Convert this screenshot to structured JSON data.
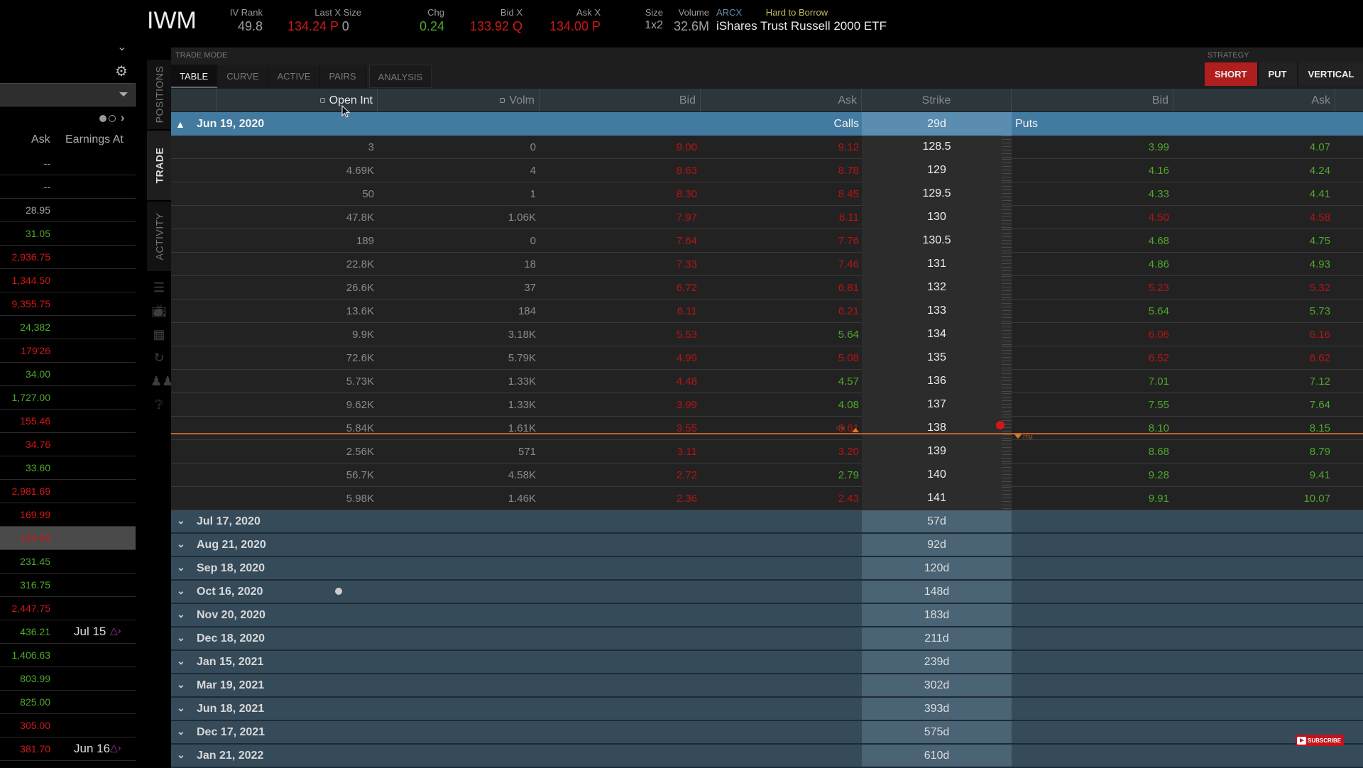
{
  "header": {
    "symbol": "IWM",
    "iv_rank": {
      "label": "IV Rank",
      "value": "49.8"
    },
    "last_x_size": {
      "label": "Last X Size",
      "value": "134.24 P",
      "size": "0"
    },
    "chg": {
      "label": "Chg",
      "value": "0.24"
    },
    "bid_x": {
      "label": "Bid X",
      "value": "133.92 Q"
    },
    "ask_x": {
      "label": "Ask X",
      "value": "134.00 P"
    },
    "size": {
      "label": "Size",
      "value": "1x2"
    },
    "volume": {
      "label": "Volume",
      "value": "32.6M"
    },
    "exchange": "ARCX",
    "borrow_status": "Hard to Borrow",
    "description": "iShares Trust Russell 2000 ETF"
  },
  "watchlist": {
    "columns": {
      "ask": "Ask",
      "earnings": "Earnings At"
    },
    "rows": [
      {
        "ask": "--",
        "color": "grey"
      },
      {
        "ask": "--",
        "color": "grey"
      },
      {
        "ask": "28.95",
        "color": "grey"
      },
      {
        "ask": "31.05",
        "color": "green"
      },
      {
        "ask": "2,936.75",
        "color": "red"
      },
      {
        "ask": "1,344.50",
        "color": "red"
      },
      {
        "ask": "9,355.75",
        "color": "red"
      },
      {
        "ask": "24,382",
        "color": "green"
      },
      {
        "ask": "179'26",
        "color": "red"
      },
      {
        "ask": "34.00",
        "color": "green"
      },
      {
        "ask": "1,727.00",
        "color": "green"
      },
      {
        "ask": "155.46",
        "color": "red"
      },
      {
        "ask": "34.76",
        "color": "red"
      },
      {
        "ask": "33.60",
        "color": "green"
      },
      {
        "ask": "2,981.69",
        "color": "red"
      },
      {
        "ask": "169.99",
        "color": "red"
      },
      {
        "ask": "134.00",
        "color": "red",
        "selected": true
      },
      {
        "ask": "231.45",
        "color": "green"
      },
      {
        "ask": "316.75",
        "color": "green"
      },
      {
        "ask": "2,447.75",
        "color": "red"
      },
      {
        "ask": "436.21",
        "color": "green",
        "earnings": "Jul 15"
      },
      {
        "ask": "1,406.63",
        "color": "green"
      },
      {
        "ask": "803.99",
        "color": "green"
      },
      {
        "ask": "825.00",
        "color": "green"
      },
      {
        "ask": "305.00",
        "color": "red"
      },
      {
        "ask": "381.70",
        "color": "red",
        "earnings": "Jun 16"
      }
    ]
  },
  "side_tabs": [
    "POSITIONS",
    "TRADE",
    "ACTIVITY"
  ],
  "active_side_tab": "TRADE",
  "trade_mode": {
    "label": "TRADE MODE",
    "tabs": [
      "TABLE",
      "CURVE",
      "ACTIVE",
      "PAIRS",
      "ANALYSIS"
    ],
    "active": "TABLE"
  },
  "strategy": {
    "label": "STRATEGY",
    "buttons": [
      "SHORT",
      "PUT",
      "VERTICAL"
    ],
    "active": "SHORT"
  },
  "chain": {
    "columns": {
      "open_int": "Open Int",
      "volm": "Volm",
      "call_bid": "Bid",
      "call_ask": "Ask",
      "strike": "Strike",
      "put_bid": "Bid",
      "put_ask": "Ask"
    },
    "expanded": {
      "date": "Jun 19, 2020",
      "calls_label": "Calls",
      "dte": "29d",
      "puts_label": "Puts"
    },
    "rows": [
      {
        "oi": "3",
        "vol": "0",
        "cb": "9.00",
        "cbc": "red",
        "ca": "9.12",
        "cac": "red",
        "strike": "128.5",
        "pb": "3.99",
        "pbc": "green",
        "pa": "4.07",
        "pac": "green"
      },
      {
        "oi": "4.69K",
        "vol": "4",
        "cb": "8.63",
        "cbc": "red",
        "ca": "8.78",
        "cac": "red",
        "strike": "129",
        "pb": "4.16",
        "pbc": "green",
        "pa": "4.24",
        "pac": "green"
      },
      {
        "oi": "50",
        "vol": "1",
        "cb": "8.30",
        "cbc": "red",
        "ca": "8.45",
        "cac": "red",
        "strike": "129.5",
        "pb": "4.33",
        "pbc": "green",
        "pa": "4.41",
        "pac": "green"
      },
      {
        "oi": "47.8K",
        "vol": "1.06K",
        "cb": "7.97",
        "cbc": "red",
        "ca": "8.11",
        "cac": "red",
        "strike": "130",
        "pb": "4.50",
        "pbc": "red",
        "pa": "4.58",
        "pac": "red"
      },
      {
        "oi": "189",
        "vol": "0",
        "cb": "7.64",
        "cbc": "red",
        "ca": "7.76",
        "cac": "red",
        "strike": "130.5",
        "pb": "4.68",
        "pbc": "green",
        "pa": "4.75",
        "pac": "green"
      },
      {
        "oi": "22.8K",
        "vol": "18",
        "cb": "7.33",
        "cbc": "red",
        "ca": "7.46",
        "cac": "red",
        "strike": "131",
        "pb": "4.86",
        "pbc": "green",
        "pa": "4.93",
        "pac": "green"
      },
      {
        "oi": "26.6K",
        "vol": "37",
        "cb": "6.72",
        "cbc": "red",
        "ca": "6.81",
        "cac": "red",
        "strike": "132",
        "pb": "5.23",
        "pbc": "red",
        "pa": "5.32",
        "pac": "red"
      },
      {
        "oi": "13.6K",
        "vol": "184",
        "cb": "6.11",
        "cbc": "red",
        "ca": "6.21",
        "cac": "red",
        "strike": "133",
        "pb": "5.64",
        "pbc": "green",
        "pa": "5.73",
        "pac": "green"
      },
      {
        "oi": "9.9K",
        "vol": "3.18K",
        "cb": "5.53",
        "cbc": "red",
        "ca": "5.64",
        "cac": "green",
        "strike": "134",
        "pb": "6.06",
        "pbc": "red",
        "pa": "6.16",
        "pac": "red"
      },
      {
        "oi": "72.6K",
        "vol": "5.79K",
        "cb": "4.99",
        "cbc": "red",
        "ca": "5.08",
        "cac": "red",
        "strike": "135",
        "pb": "6.52",
        "pbc": "red",
        "pa": "6.62",
        "pac": "red"
      },
      {
        "oi": "5.73K",
        "vol": "1.33K",
        "cb": "4.48",
        "cbc": "red",
        "ca": "4.57",
        "cac": "green",
        "strike": "136",
        "pb": "7.01",
        "pbc": "green",
        "pa": "7.12",
        "pac": "green"
      },
      {
        "oi": "9.62K",
        "vol": "1.33K",
        "cb": "3.99",
        "cbc": "red",
        "ca": "4.08",
        "cac": "green",
        "strike": "137",
        "pb": "7.55",
        "pbc": "green",
        "pa": "7.64",
        "pac": "green"
      },
      {
        "oi": "5.84K",
        "vol": "1.61K",
        "cb": "3.55",
        "cbc": "red",
        "ca": "3.61",
        "cac": "red",
        "strike": "138",
        "pb": "8.10",
        "pbc": "green",
        "pa": "8.15",
        "pac": "green"
      },
      {
        "oi": "2.56K",
        "vol": "571",
        "cb": "3.11",
        "cbc": "red",
        "ca": "3.20",
        "cac": "red",
        "strike": "139",
        "pb": "8.68",
        "pbc": "green",
        "pa": "8.79",
        "pac": "green"
      },
      {
        "oi": "56.7K",
        "vol": "4.58K",
        "cb": "2.72",
        "cbc": "red",
        "ca": "2.79",
        "cac": "green",
        "strike": "140",
        "pb": "9.28",
        "pbc": "green",
        "pa": "9.41",
        "pac": "green"
      },
      {
        "oi": "5.98K",
        "vol": "1.46K",
        "cb": "2.36",
        "cbc": "red",
        "ca": "2.43",
        "cac": "red",
        "strike": "141",
        "pb": "9.91",
        "pbc": "green",
        "pa": "10.07",
        "pac": "green"
      }
    ],
    "itm_label": "ITM",
    "expirations": [
      {
        "date": "Jul 17, 2020",
        "dte": "57d"
      },
      {
        "date": "Aug 21, 2020",
        "dte": "92d"
      },
      {
        "date": "Sep 18, 2020",
        "dte": "120d"
      },
      {
        "date": "Oct 16, 2020",
        "dte": "148d",
        "marker": true
      },
      {
        "date": "Nov 20, 2020",
        "dte": "183d"
      },
      {
        "date": "Dec 18, 2020",
        "dte": "211d"
      },
      {
        "date": "Jan 15, 2021",
        "dte": "239d"
      },
      {
        "date": "Mar 19, 2021",
        "dte": "302d"
      },
      {
        "date": "Jun 18, 2021",
        "dte": "393d"
      },
      {
        "date": "Dec 17, 2021",
        "dte": "575d"
      },
      {
        "date": "Jan 21, 2022",
        "dte": "610d"
      }
    ]
  },
  "overlay": {
    "subscribe": "SUBSCRIBE"
  },
  "colors": {
    "red": "#b51414",
    "green": "#4ea82a",
    "accent_blue": "#437aa0",
    "strategy_active": "#b01e1e",
    "itm_line": "#c0602c"
  }
}
